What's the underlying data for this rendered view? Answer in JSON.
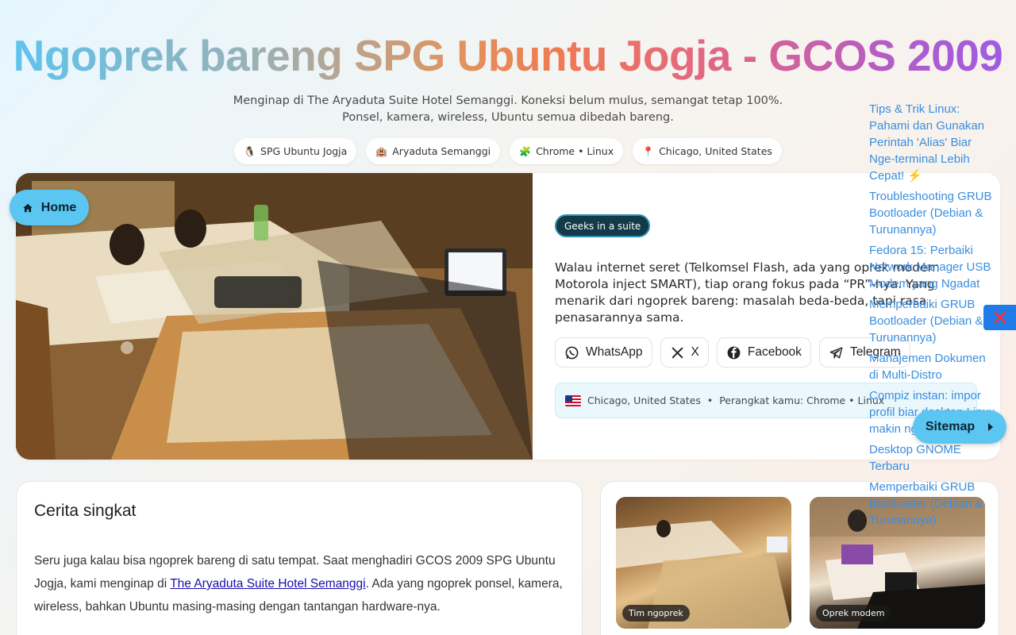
{
  "hero": {
    "title": "Ngoprek bareng SPG Ubuntu Jogja - GCOS 2009",
    "subtitle": "Menginap di The Aryaduta Suite Hotel Semanggi. Koneksi belum mulus, semangat tetap 100%. Ponsel, kamera, wireless, Ubuntu semua dibedah bareng.",
    "chips": [
      {
        "icon": "penguin-icon",
        "glyph": "🐧",
        "label": "SPG Ubuntu Jogja"
      },
      {
        "icon": "hotel-icon",
        "glyph": "🏨",
        "label": "Aryaduta Semanggi"
      },
      {
        "icon": "puzzle-icon",
        "glyph": "🧩",
        "label": "Chrome • Linux"
      },
      {
        "icon": "pin-icon",
        "glyph": "📍",
        "label": "Chicago, United States"
      }
    ]
  },
  "nav": {
    "home_label": "Home",
    "sitemap_label": "Sitemap"
  },
  "feature": {
    "tag": "Geeks in a suite",
    "text": "Walau internet seret (Telkomsel Flash, ada yang oprek modem Motorola inject SMART), tiap orang fokus pada “PR”-nya. Yang menarik dari ngoprek bareng: masalah beda-beda, tapi rasa penasarannya sama.",
    "share": [
      "WhatsApp",
      "X",
      "Facebook",
      "Telegram"
    ],
    "geo": {
      "location": "Chicago, United States",
      "separator": "•",
      "device": "Perangkat kamu: Chrome • Linux"
    }
  },
  "story": {
    "heading": "Cerita singkat",
    "text_before": "Seru juga kalau bisa ngoprek bareng di satu tempat. Saat menghadiri GCOS 2009 SPG Ubuntu Jogja, kami menginap di ",
    "link": "The Aryaduta Suite Hotel Semanggi",
    "text_after": ". Ada yang ngoprek ponsel, kamera, wireless, bahkan Ubuntu masing-masing dengan tantangan hardware-nya."
  },
  "gallery": {
    "captions": [
      "Tim ngoprek",
      "Oprek modem"
    ]
  },
  "sitemap": {
    "links": [
      "Tips & Trik Linux: Pahami dan Gunakan Perintah 'Alias' Biar Nge-terminal Lebih Cepat! ⚡",
      "Troubleshooting GRUB Bootloader (Debian & Turunannya)",
      "Fedora 15: Perbaiki Network Manager USB Modem yang Ngadat",
      "Memperbaiki GRUB Bootloader (Debian & Turunannya)",
      "Manajemen Dokumen di Multi-Distro",
      "Compiz instan: impor profil biar desktop Linux makin ngebut",
      "Desktop GNOME Terbaru",
      "Memperbaiki GRUB Bootloader (Debian & Turunannya)"
    ]
  },
  "colors": {
    "accent": "#5cc6f2",
    "tag_bg": "#123a49",
    "link": "#3a8ee0",
    "close": "#1f7be8"
  }
}
